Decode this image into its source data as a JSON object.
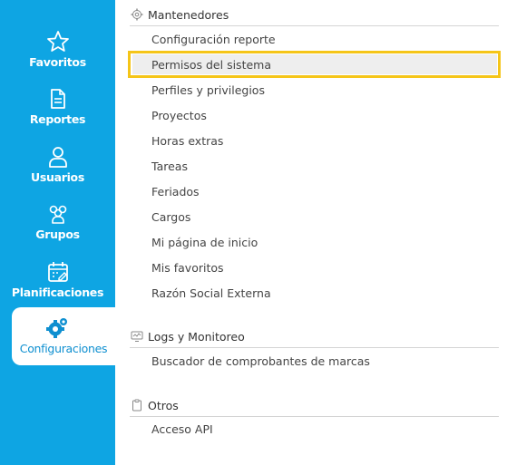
{
  "sidebar": {
    "items": [
      {
        "label": "Favoritos",
        "icon": "star-icon"
      },
      {
        "label": "Reportes",
        "icon": "document-icon"
      },
      {
        "label": "Usuarios",
        "icon": "user-icon"
      },
      {
        "label": "Grupos",
        "icon": "group-icon"
      },
      {
        "label": "Planificaciones",
        "icon": "calendar-icon"
      },
      {
        "label": "Configuraciones",
        "icon": "gear-icon",
        "active": true
      }
    ],
    "colors": {
      "background": "#0ea5e3",
      "active_text": "#0e8fd0"
    }
  },
  "sections": [
    {
      "title": "Mantenedores",
      "icon": "gear-icon",
      "items": [
        "Configuración reporte",
        "Permisos del sistema",
        "Perfiles y privilegios",
        "Proyectos",
        "Horas extras",
        "Tareas",
        "Feriados",
        "Cargos",
        "Mi página de inicio",
        "Mis favoritos",
        "Razón Social Externa"
      ],
      "highlighted_index": 1
    },
    {
      "title": "Logs y Monitoreo",
      "icon": "monitor-icon",
      "items": [
        "Buscador de comprobantes de marcas"
      ]
    },
    {
      "title": "Otros",
      "icon": "clipboard-icon",
      "items": [
        "Acceso API"
      ]
    }
  ],
  "colors": {
    "highlight_border": "#f5c518",
    "highlight_bg": "#eeeeee"
  }
}
